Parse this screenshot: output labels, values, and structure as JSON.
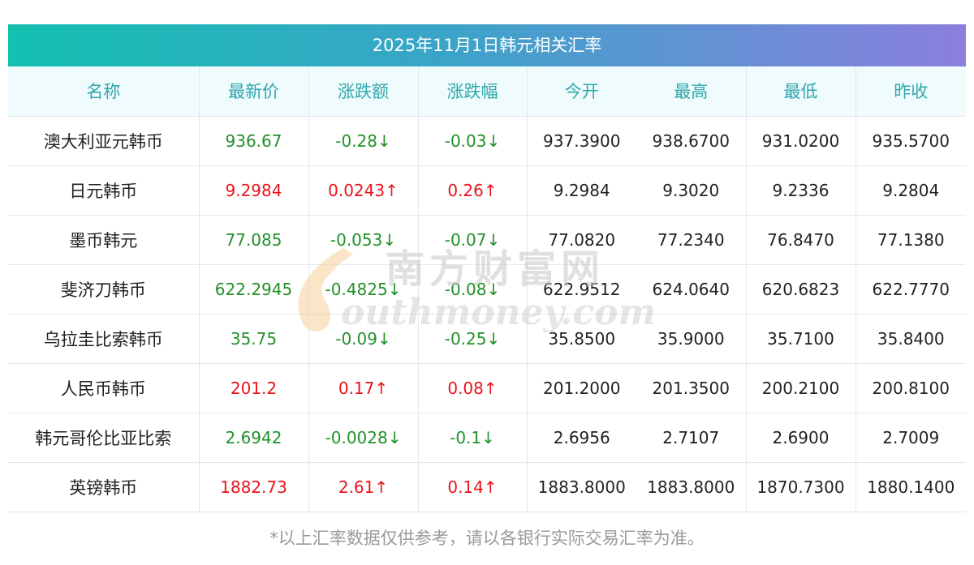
{
  "title": "2025年11月1日韩元相关汇率",
  "headers": [
    "名称",
    "最新价",
    "涨跌额",
    "涨跌幅",
    "今开",
    "最高",
    "最低",
    "昨收"
  ],
  "colors": {
    "up": "#e8141b",
    "down": "#21912a",
    "header_text": "#2fa7ac",
    "header_bg": "#effbfc"
  },
  "rows": [
    {
      "name": "澳大利亚元韩币",
      "latest": "936.67",
      "change": "-0.28↓",
      "pct": "-0.03↓",
      "dir": "down",
      "open": "937.3900",
      "high": "938.6700",
      "low": "931.0200",
      "prev": "935.5700"
    },
    {
      "name": "日元韩币",
      "latest": "9.2984",
      "change": "0.0243↑",
      "pct": "0.26↑",
      "dir": "up",
      "open": "9.2984",
      "high": "9.3020",
      "low": "9.2336",
      "prev": "9.2804"
    },
    {
      "name": "墨币韩元",
      "latest": "77.085",
      "change": "-0.053↓",
      "pct": "-0.07↓",
      "dir": "down",
      "open": "77.0820",
      "high": "77.2340",
      "low": "76.8470",
      "prev": "77.1380"
    },
    {
      "name": "斐济刀韩币",
      "latest": "622.2945",
      "change": "-0.4825↓",
      "pct": "-0.08↓",
      "dir": "down",
      "open": "622.9512",
      "high": "624.0640",
      "low": "620.6823",
      "prev": "622.7770"
    },
    {
      "name": "乌拉圭比索韩币",
      "latest": "35.75",
      "change": "-0.09↓",
      "pct": "-0.25↓",
      "dir": "down",
      "open": "35.8500",
      "high": "35.9000",
      "low": "35.7100",
      "prev": "35.8400"
    },
    {
      "name": "人民币韩币",
      "latest": "201.2",
      "change": "0.17↑",
      "pct": "0.08↑",
      "dir": "up",
      "open": "201.2000",
      "high": "201.3500",
      "low": "200.2100",
      "prev": "200.8100"
    },
    {
      "name": "韩元哥伦比亚比索",
      "latest": "2.6942",
      "change": "-0.0028↓",
      "pct": "-0.1↓",
      "dir": "down",
      "open": "2.6956",
      "high": "2.7107",
      "low": "2.6900",
      "prev": "2.7009"
    },
    {
      "name": "英镑韩币",
      "latest": "1882.73",
      "change": "2.61↑",
      "pct": "0.14↑",
      "dir": "up",
      "open": "1883.8000",
      "high": "1883.8000",
      "low": "1870.7300",
      "prev": "1880.1400"
    }
  ],
  "watermark": {
    "cn": "南方财富网",
    "en": "outhmoney.com"
  },
  "footnote": "*以上汇率数据仅供参考，请以各银行实际交易汇率为准。"
}
